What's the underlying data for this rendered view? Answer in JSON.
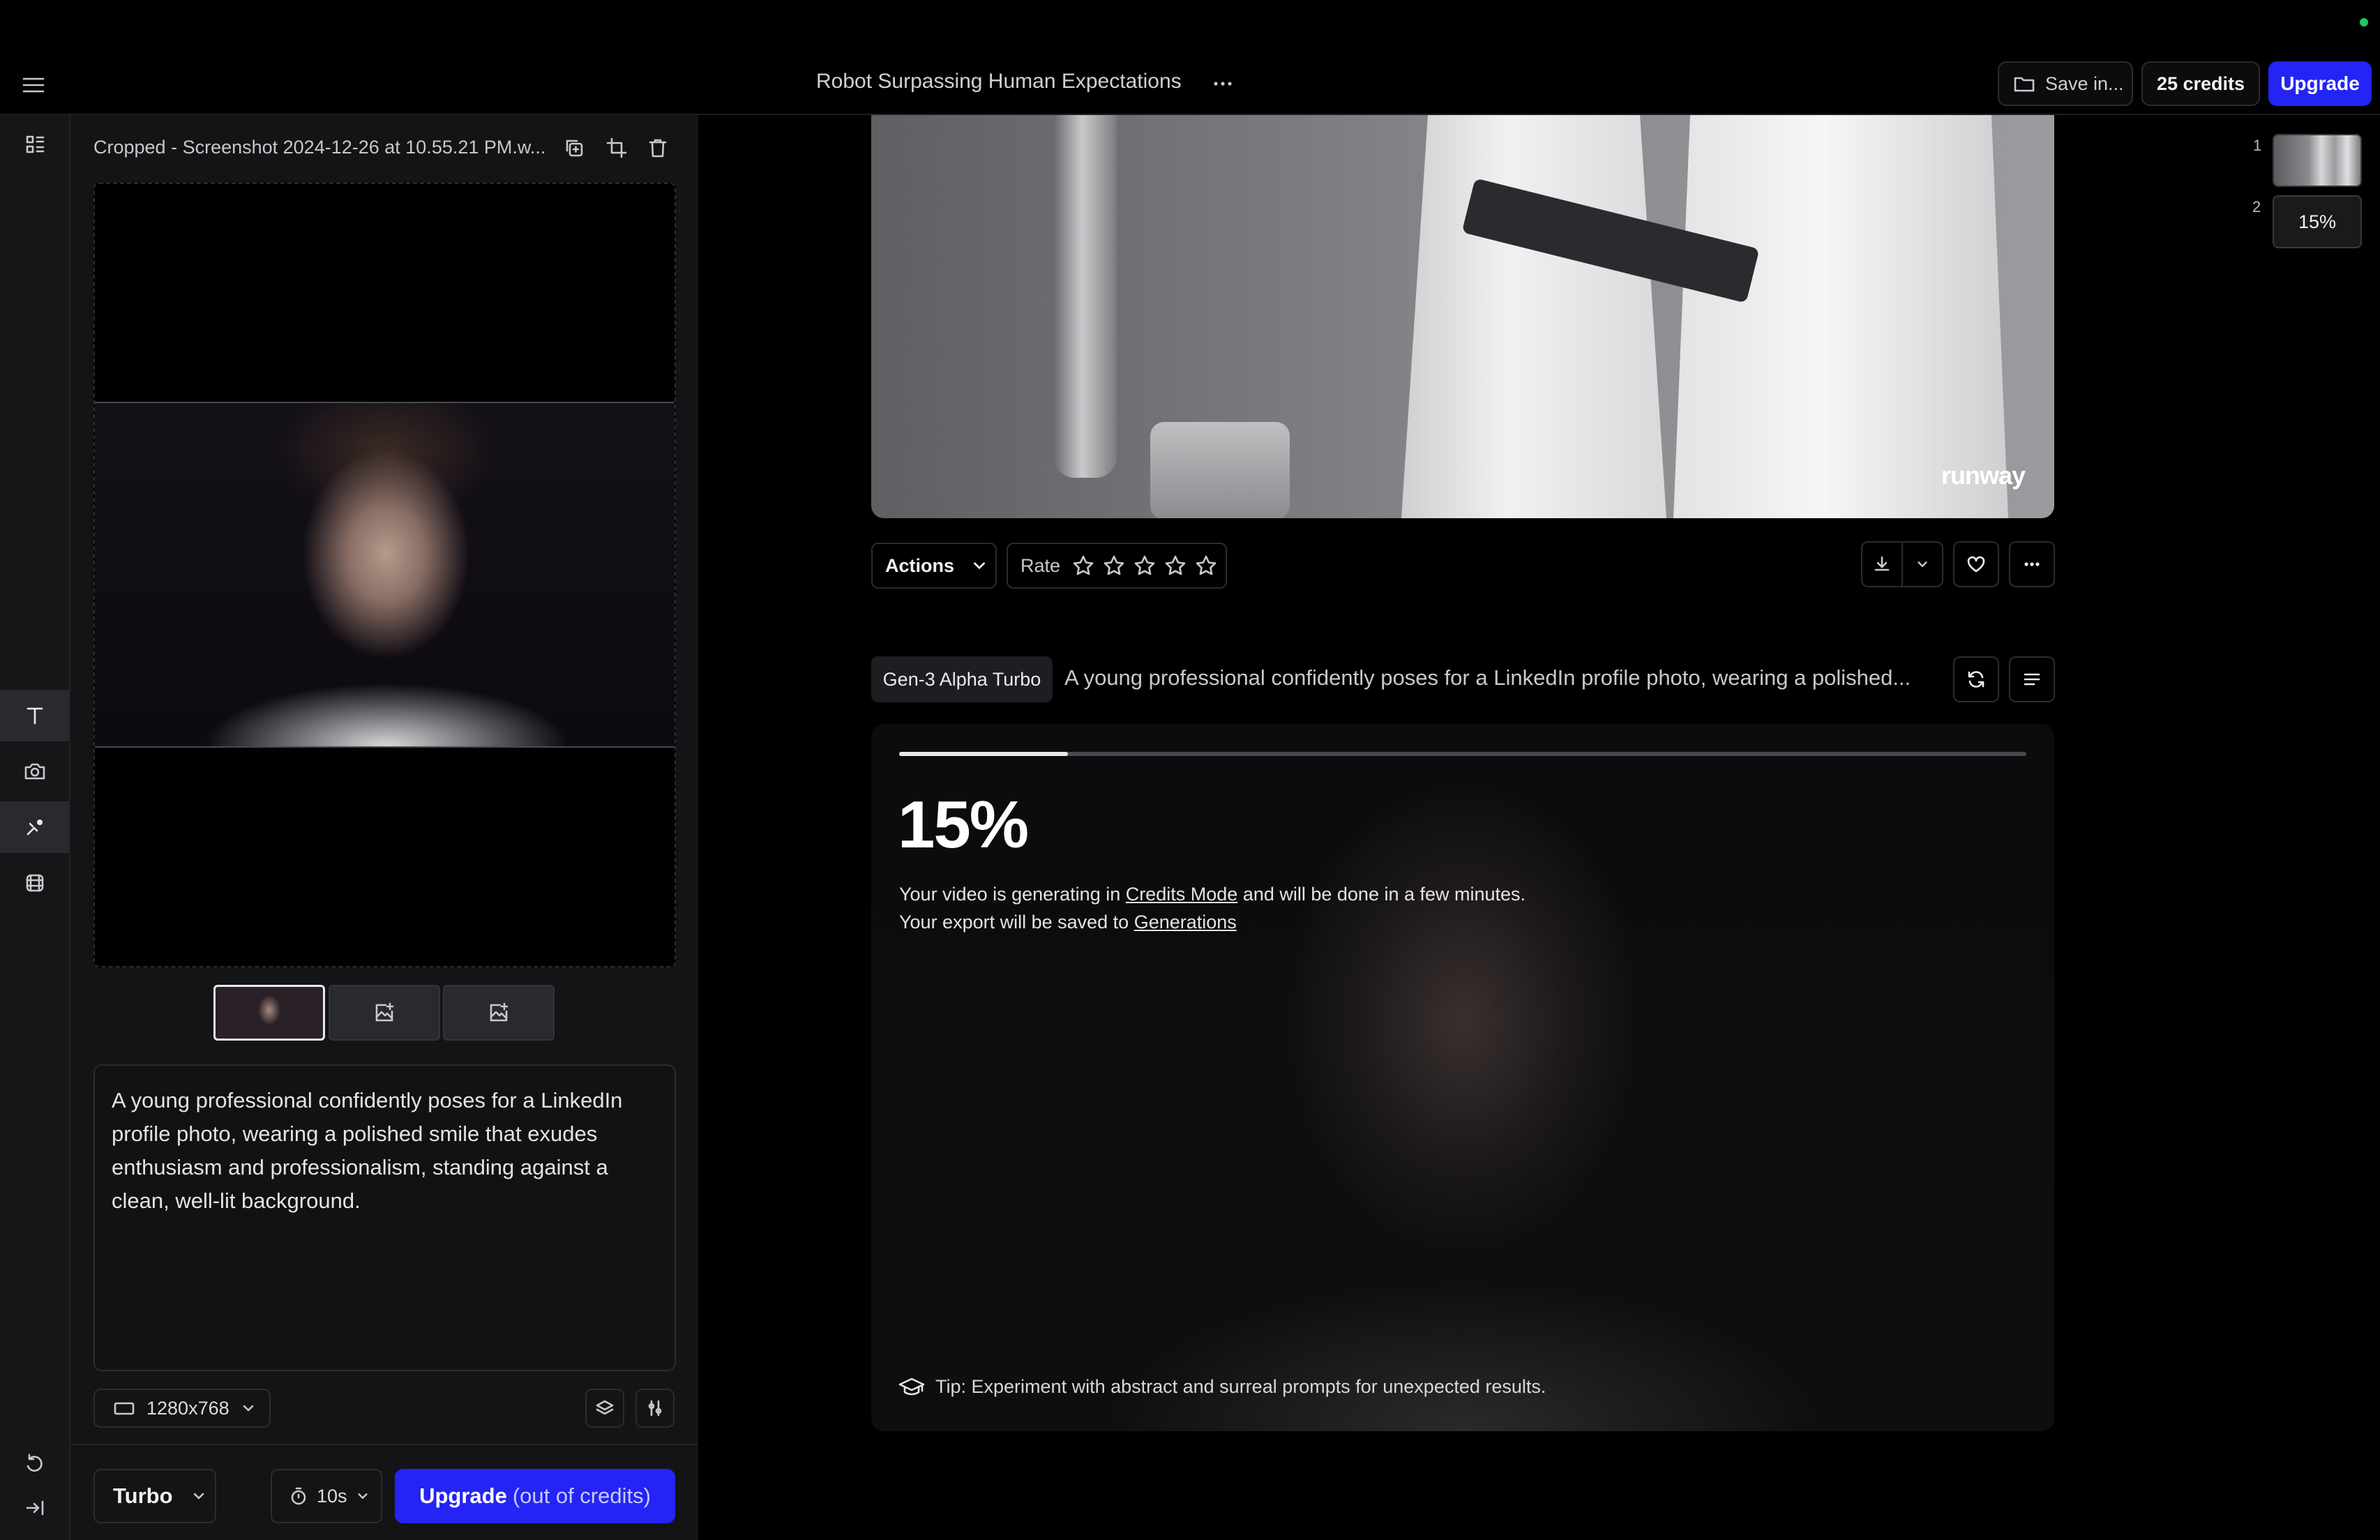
{
  "header": {
    "project_title": "Robot Surpassing Human Expectations",
    "save_label": "Save in...",
    "credits_label": "25 credits",
    "upgrade_label": "Upgrade"
  },
  "rail": {
    "items": [
      "layout-icon",
      "text-icon",
      "camera-icon",
      "motion-brush-icon",
      "frames-icon",
      "undo-icon",
      "collapse-icon"
    ],
    "active": "motion-brush-icon"
  },
  "left_panel": {
    "asset_name": "Cropped - Screenshot 2024-12-26 at 10.55.21 PM.w...",
    "prompt_text": "A young professional confidently poses for a LinkedIn profile photo, wearing a polished smile that exudes enthusiasm and professionalism, standing against a clean, well-lit background.",
    "resolution": "1280x768",
    "mode": "Turbo",
    "duration": "10s",
    "generate_label": "Upgrade",
    "generate_sub": "(out of credits)"
  },
  "main": {
    "watermark": "runway",
    "actions_label": "Actions",
    "rate_label": "Rate",
    "rating": 0,
    "model_badge": "Gen-3 Alpha Turbo",
    "prompt_preview": "A young professional confidently poses for a LinkedIn profile photo, wearing a polished...",
    "progress_pct_text": "15%",
    "progress_fraction": 0.15,
    "msg_line1_pre": "Your video is generating in ",
    "msg_line1_link": "Credits Mode",
    "msg_line1_post": " and will be done in a few minutes.",
    "msg_line2_pre": "Your export will be saved to ",
    "msg_line2_link": "Generations",
    "tip_text": "Tip: Experiment with abstract and surreal prompts for unexpected results."
  },
  "queue": {
    "items": [
      {
        "num": "1",
        "label": ""
      },
      {
        "num": "2",
        "label": "15%"
      }
    ]
  },
  "colors": {
    "accent": "#2424f5",
    "status_dot": "#22c55e"
  }
}
